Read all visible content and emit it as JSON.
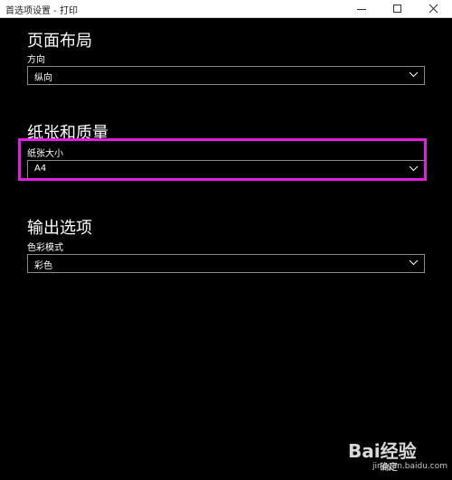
{
  "window": {
    "title": "首选项设置 - 打印"
  },
  "sections": [
    {
      "title": "页面布局",
      "field_label": "方向",
      "value": "纵向"
    },
    {
      "title": "纸张和质量",
      "field_label": "纸张大小",
      "value": "A4"
    },
    {
      "title": "输出选项",
      "field_label": "色彩模式",
      "value": "彩色"
    }
  ],
  "highlight": {
    "color": "#e020e0"
  },
  "watermark": {
    "brand": "Bai经验",
    "url": "jingyan.baidu.com",
    "confirm_label": "确定"
  }
}
